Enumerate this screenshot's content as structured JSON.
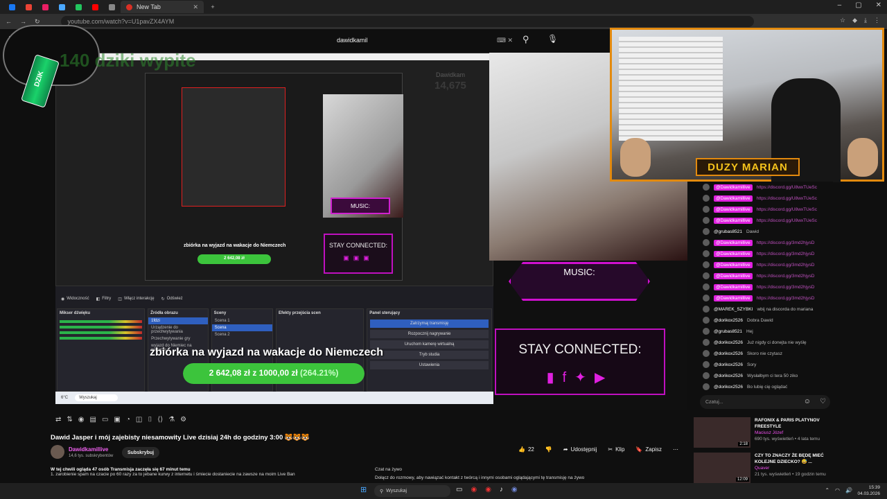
{
  "browser": {
    "tabs": [
      {
        "label": "",
        "color": "#1877f2"
      },
      {
        "label": "",
        "color": "#ea4335"
      },
      {
        "label": "",
        "color": "#e91e63"
      },
      {
        "label": "",
        "color": "#4aa8ff"
      },
      {
        "label": "",
        "color": "#22c55e"
      },
      {
        "label": "",
        "color": "#ff0000"
      },
      {
        "label": "",
        "color": "#888888"
      }
    ],
    "active_tab": "New Tab",
    "url": "youtube.com/watch?v=U1pavZX4AYM"
  },
  "search": {
    "query": "dawidkamil"
  },
  "overlay": {
    "title": "140 dziki wypite",
    "can_text": "DZIK"
  },
  "stream": {
    "inner_name": "Dawidkam",
    "inner_score": "14,675",
    "music": "MUSIC:",
    "stay": "STAY CONNECTED:",
    "zbiorka": "zbiórka na wyjazd na wakacje do Niemczech",
    "progress_amount": "2 642,08 zł",
    "progress_of": "z",
    "progress_goal": "1000,00 zł",
    "progress_pct": "(264.21%)",
    "progress_fill": 1.0,
    "marian": "DUZY MARIAN",
    "obs_tabs": [
      "Widoczność",
      "Filtry",
      "Włącz interakcję",
      "Odśwież"
    ],
    "obs_panels": {
      "mixer": "Mikser dźwięku",
      "sources": "Źródła obrazu",
      "scenes": "Sceny",
      "transitions": "Efekty przejścia scen",
      "controls": "Panel sterujący"
    },
    "obs_sources": [
      "1fdzi",
      "Urządzenie do przechwytywania",
      "Przechwytywanie gry",
      "wyjazd do Niemiec na wakacje"
    ],
    "obs_scenes": [
      "Scena 1",
      "Scena",
      "Scena 2"
    ],
    "obs_buttons": [
      "Zatrzymaj transmisję",
      "Rozpocznij nagrywanie",
      "Uruchom kamerę wirtualną",
      "Tryb studia",
      "Ustawienia"
    ],
    "inner_taskbar_search": "Wyszukaj",
    "weather": "6°C"
  },
  "chat": {
    "messages": [
      {
        "author": "@Dawidkamillive",
        "text": "https://discord.gg/U8wxTUeSc",
        "mod": true
      },
      {
        "author": "@Dawidkamillive",
        "text": "https://discord.gg/U8wxTUeSc",
        "mod": true
      },
      {
        "author": "@Dawidkamillive",
        "text": "https://discord.gg/U8wxTUeSc",
        "mod": true
      },
      {
        "author": "@Dawidkamillive",
        "text": "https://discord.gg/U8wxTUeSc",
        "mod": true
      },
      {
        "author": "@grubas8521",
        "text": "Dawid",
        "mod": false
      },
      {
        "author": "@Dawidkamillive",
        "text": "https://discord.gg/3md2hjysD",
        "mod": true
      },
      {
        "author": "@Dawidkamillive",
        "text": "https://discord.gg/3md2hjysD",
        "mod": true
      },
      {
        "author": "@Dawidkamillive",
        "text": "https://discord.gg/3md2hjysD",
        "mod": true
      },
      {
        "author": "@Dawidkamillive",
        "text": "https://discord.gg/3md2hjysD",
        "mod": true
      },
      {
        "author": "@Dawidkamillive",
        "text": "https://discord.gg/3md2hjysD",
        "mod": true
      },
      {
        "author": "@Dawidkamillive",
        "text": "https://discord.gg/3md2hjysD",
        "mod": true
      },
      {
        "author": "@MAREK_SZYBKI",
        "text": "wbij na discorda do mariana",
        "mod": false
      },
      {
        "author": "@dorikox2526",
        "text": "Dobra Dawid",
        "mod": false
      },
      {
        "author": "@grubas8521",
        "text": "Hej",
        "mod": false
      },
      {
        "author": "@dorikox2526",
        "text": "Już nigdy ci donejta nie wyślę",
        "mod": false
      },
      {
        "author": "@dorikox2526",
        "text": "Skoro nie czytasz",
        "mod": false
      },
      {
        "author": "@dorikox2526",
        "text": "Sory",
        "mod": false
      },
      {
        "author": "@dorikox2526",
        "text": "Wysłałbym ci tera 50 ziko",
        "mod": false
      },
      {
        "author": "@dorikox2526",
        "text": "Bo lubię cię oglądać",
        "mod": false
      }
    ],
    "input_placeholder": "Czatuj..."
  },
  "video": {
    "title": "Dawid Jasper i mój zajebisty niesamowity Live dzisiaj 24h do godziny 3:00 🐯🐯🐯",
    "channel": "Dawidkamillive",
    "subscribers": "14,6 tys. subskrybentów",
    "subscribe": "Subskrybuj",
    "likes": "22",
    "share": "Udostępnij",
    "clip": "Klip",
    "save": "Zapisz",
    "watching": "W tej chwili ogląda 47 osób",
    "started": "Transmisja zaczęła się 67 minut temu",
    "desc_line": "1. zarobienie spam na czacie po 60 razy za to jebane kurwy z internetu i śmiecie dostaniecie na zawsze na moim Live Ban",
    "chat_replay_title": "Czat na żywo",
    "chat_replay_line": "Dołącz do rozmowy, aby nawiązać kontakt z twórcą i innymi osobami oglądającymi tę transmisję na żywo"
  },
  "recommendations": [
    {
      "title": "RAFONIX & PARIS PLATYNOV FREESTYLE",
      "channel": "Maciusz Józef",
      "meta": "690 tys. wyświetleń • 4 lata temu",
      "duration": "2:18"
    },
    {
      "title": "CZY TO ZNACZY ŻE BĘDĘ MIEĆ KOLEJNE DZIECKO? 😅 ...",
      "channel": "Quaver",
      "meta": "21 tys. wyświetleń • 19 godzin temu",
      "duration": "12:09"
    }
  ],
  "taskbar": {
    "search": "Wyszukaj",
    "time": "15:39",
    "date": "04.03.2026"
  }
}
